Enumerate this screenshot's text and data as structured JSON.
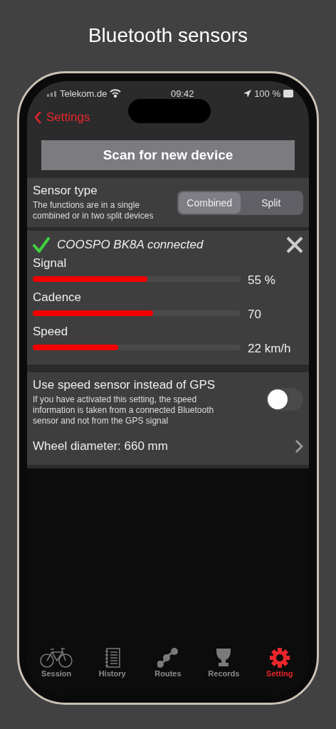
{
  "headline": "Bluetooth sensors",
  "status_bar": {
    "carrier": "Telekom.de",
    "time": "09:42",
    "battery": "100 %"
  },
  "nav": {
    "back": "Settings"
  },
  "scan_button": "Scan for new device",
  "sensor_type": {
    "title": "Sensor type",
    "description": "The functions are in a single combined or in two split devices",
    "segments": [
      {
        "label": "Combined",
        "selected": true
      },
      {
        "label": "Split",
        "selected": false
      }
    ]
  },
  "device": {
    "connected": true,
    "name": "COOSPO BK8A connected",
    "metrics": [
      {
        "label": "Signal",
        "level": 0.55,
        "reading": "55 %"
      },
      {
        "label": "Cadence",
        "level": 0.58,
        "reading": "70"
      },
      {
        "label": "Speed",
        "level": 0.41,
        "reading": "22 km/h"
      }
    ]
  },
  "speed_sensor": {
    "title": "Use speed sensor instead of GPS",
    "description": "If you have activated this setting, the speed information is taken from a connected Bluetooth sensor and not from the GPS signal",
    "on": false,
    "wheel": "Wheel diameter: 660 mm"
  },
  "tabs": [
    {
      "kind": "bike",
      "label": "Session",
      "selected": false
    },
    {
      "kind": "notebook",
      "label": "History",
      "selected": false
    },
    {
      "kind": "route",
      "label": "Routes",
      "selected": false
    },
    {
      "kind": "trophy",
      "label": "Records",
      "selected": false
    },
    {
      "kind": "gear",
      "label": "Setting",
      "selected": true
    }
  ]
}
